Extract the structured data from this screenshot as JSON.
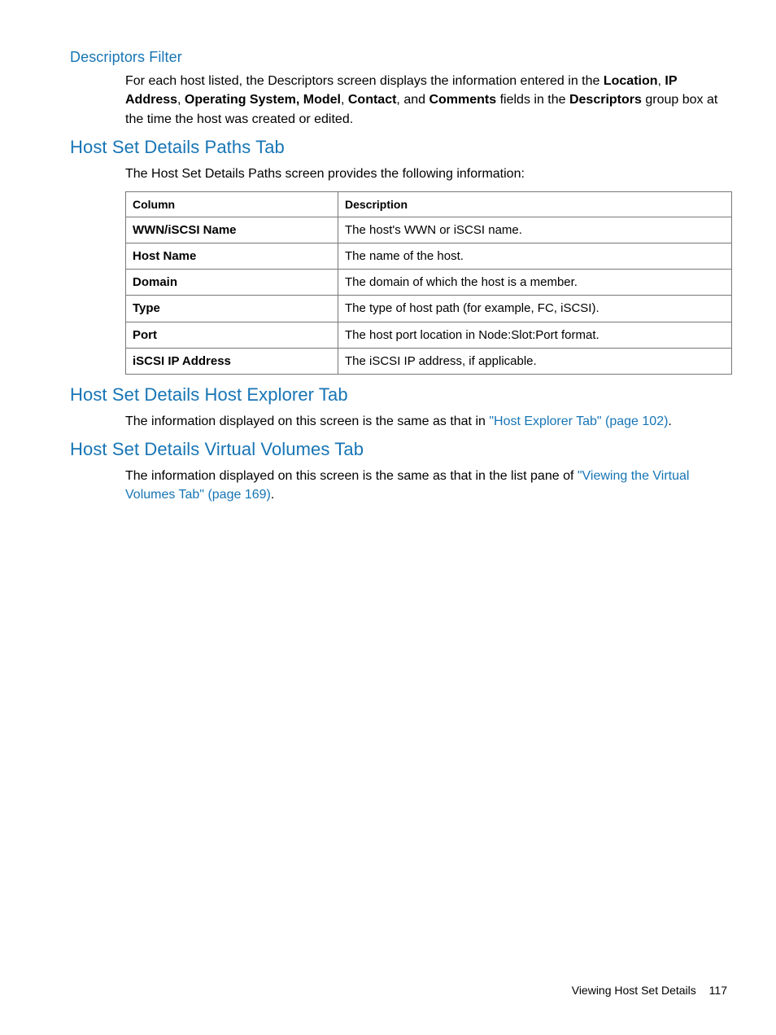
{
  "sections": {
    "descriptorsFilter": {
      "heading": "Descriptors Filter",
      "para_parts": {
        "p0": "For each host listed, the Descriptors screen displays the information entered in the ",
        "b0": "Location",
        "p1": ", ",
        "b1": "IP Address",
        "p2": ", ",
        "b2": "Operating System, Model",
        "p3": ", ",
        "b3": "Contact",
        "p4": ", and ",
        "b4": "Comments",
        "p5": " fields in the ",
        "b5": "Descriptors",
        "p6": " group box at the time the host was created or edited."
      }
    },
    "pathsTab": {
      "heading": "Host Set Details Paths Tab",
      "intro": "The Host Set Details Paths screen provides the following information:",
      "table": {
        "header": {
          "col": "Column",
          "desc": "Description"
        },
        "rows": [
          {
            "col": "WWN/iSCSI Name",
            "desc": "The host's WWN or iSCSI name."
          },
          {
            "col": "Host Name",
            "desc": "The name of the host."
          },
          {
            "col": "Domain",
            "desc": "The domain of which the host is a member."
          },
          {
            "col": "Type",
            "desc": "The type of host path (for example, FC, iSCSI)."
          },
          {
            "col": "Port",
            "desc": "The host port location in Node:Slot:Port format."
          },
          {
            "col": "iSCSI IP Address",
            "desc": "The iSCSI IP address, if applicable."
          }
        ]
      }
    },
    "hostExplorerTab": {
      "heading": "Host Set Details Host Explorer Tab",
      "para_parts": {
        "p0": "The information displayed on this screen is the same as that in ",
        "link": "\"Host Explorer Tab\" (page 102)",
        "p1": "."
      }
    },
    "virtualVolumesTab": {
      "heading": "Host Set Details Virtual Volumes Tab",
      "para_parts": {
        "p0": "The information displayed on this screen is the same as that in the list pane of ",
        "link": "\"Viewing the Virtual Volumes Tab\" (page 169)",
        "p1": "."
      }
    }
  },
  "footer": {
    "section": "Viewing Host Set Details",
    "page": "117"
  }
}
